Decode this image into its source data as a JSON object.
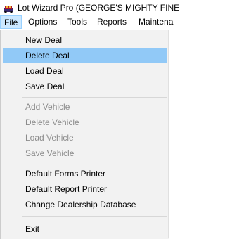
{
  "window": {
    "title": "Lot Wizard Pro (GEORGE'S  MIGHTY FINE",
    "icon": "car-app-icon"
  },
  "menubar": {
    "items": [
      {
        "label": "File",
        "open": true
      },
      {
        "label": "Options"
      },
      {
        "label": "Tools"
      },
      {
        "label": "Reports"
      },
      {
        "label": "Maintena"
      }
    ]
  },
  "file_menu": {
    "groups": [
      {
        "items": [
          {
            "label": "New Deal",
            "enabled": true
          },
          {
            "label": "Delete Deal",
            "enabled": true,
            "highlighted": true
          },
          {
            "label": "Load Deal",
            "enabled": true
          },
          {
            "label": "Save Deal",
            "enabled": true
          }
        ]
      },
      {
        "items": [
          {
            "label": "Add Vehicle",
            "enabled": false
          },
          {
            "label": "Delete Vehicle",
            "enabled": false
          },
          {
            "label": "Load Vehicle",
            "enabled": false
          },
          {
            "label": "Save Vehicle",
            "enabled": false
          }
        ]
      },
      {
        "items": [
          {
            "label": "Default Forms Printer",
            "enabled": true
          },
          {
            "label": "Default Report Printer",
            "enabled": true
          },
          {
            "label": "Change Dealership Database",
            "enabled": true
          }
        ]
      },
      {
        "items": [
          {
            "label": "Exit",
            "enabled": true
          }
        ]
      }
    ]
  },
  "colors": {
    "highlight": "#91c9f7",
    "menu_background": "#f2f2f2",
    "disabled_text": "#8c8c8c"
  }
}
